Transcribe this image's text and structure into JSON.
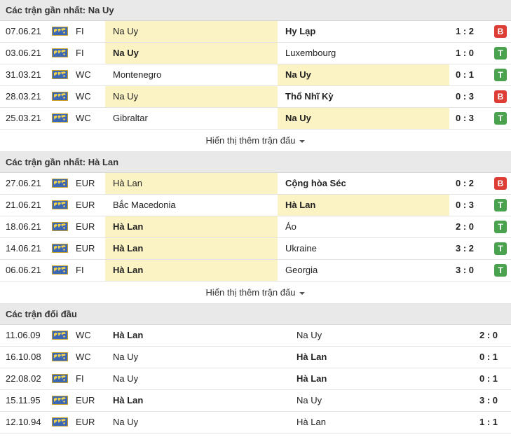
{
  "section1": {
    "title": "Các trận gần nhất: Na Uy",
    "rows": [
      {
        "date": "07.06.21",
        "comp": "FI",
        "home": "Na Uy",
        "away": "Hy Lạp",
        "score": "1 : 2",
        "result": "B",
        "home_hl": true,
        "away_hl": false,
        "home_bold": false,
        "away_bold": true
      },
      {
        "date": "03.06.21",
        "comp": "FI",
        "home": "Na Uy",
        "away": "Luxembourg",
        "score": "1 : 0",
        "result": "T",
        "home_hl": true,
        "away_hl": false,
        "home_bold": true,
        "away_bold": false
      },
      {
        "date": "31.03.21",
        "comp": "WC",
        "home": "Montenegro",
        "away": "Na Uy",
        "score": "0 : 1",
        "result": "T",
        "home_hl": false,
        "away_hl": true,
        "home_bold": false,
        "away_bold": true
      },
      {
        "date": "28.03.21",
        "comp": "WC",
        "home": "Na Uy",
        "away": "Thổ Nhĩ Kỳ",
        "score": "0 : 3",
        "result": "B",
        "home_hl": true,
        "away_hl": false,
        "home_bold": false,
        "away_bold": true
      },
      {
        "date": "25.03.21",
        "comp": "WC",
        "home": "Gibraltar",
        "away": "Na Uy",
        "score": "0 : 3",
        "result": "T",
        "home_hl": false,
        "away_hl": true,
        "home_bold": false,
        "away_bold": true
      }
    ],
    "more": "Hiển thị thêm trận đấu"
  },
  "section2": {
    "title": "Các trận gần nhất: Hà Lan",
    "rows": [
      {
        "date": "27.06.21",
        "comp": "EUR",
        "home": "Hà Lan",
        "away": "Cộng hòa Séc",
        "score": "0 : 2",
        "result": "B",
        "home_hl": true,
        "away_hl": false,
        "home_bold": false,
        "away_bold": true
      },
      {
        "date": "21.06.21",
        "comp": "EUR",
        "home": "Bắc Macedonia",
        "away": "Hà Lan",
        "score": "0 : 3",
        "result": "T",
        "home_hl": false,
        "away_hl": true,
        "home_bold": false,
        "away_bold": true
      },
      {
        "date": "18.06.21",
        "comp": "EUR",
        "home": "Hà Lan",
        "away": "Áo",
        "score": "2 : 0",
        "result": "T",
        "home_hl": true,
        "away_hl": false,
        "home_bold": true,
        "away_bold": false
      },
      {
        "date": "14.06.21",
        "comp": "EUR",
        "home": "Hà Lan",
        "away": "Ukraine",
        "score": "3 : 2",
        "result": "T",
        "home_hl": true,
        "away_hl": false,
        "home_bold": true,
        "away_bold": false
      },
      {
        "date": "06.06.21",
        "comp": "FI",
        "home": "Hà Lan",
        "away": "Georgia",
        "score": "3 : 0",
        "result": "T",
        "home_hl": true,
        "away_hl": false,
        "home_bold": true,
        "away_bold": false
      }
    ],
    "more": "Hiển thị thêm trận đấu"
  },
  "section3": {
    "title": "Các trận đối đầu",
    "rows": [
      {
        "date": "11.06.09",
        "comp": "WC",
        "home": "Hà Lan",
        "away": "Na Uy",
        "score": "2 : 0",
        "home_bold": true,
        "away_bold": false
      },
      {
        "date": "16.10.08",
        "comp": "WC",
        "home": "Na Uy",
        "away": "Hà Lan",
        "score": "0 : 1",
        "home_bold": false,
        "away_bold": true
      },
      {
        "date": "22.08.02",
        "comp": "FI",
        "home": "Na Uy",
        "away": "Hà Lan",
        "score": "0 : 1",
        "home_bold": false,
        "away_bold": true
      },
      {
        "date": "15.11.95",
        "comp": "EUR",
        "home": "Hà Lan",
        "away": "Na Uy",
        "score": "3 : 0",
        "home_bold": true,
        "away_bold": false
      },
      {
        "date": "12.10.94",
        "comp": "EUR",
        "home": "Na Uy",
        "away": "Hà Lan",
        "score": "1 : 1",
        "home_bold": false,
        "away_bold": false
      }
    ]
  },
  "icons": {
    "competition": "world-map-flag-icon",
    "more": "caret-down-icon"
  },
  "colors": {
    "highlight": "#fcf3c4",
    "loss": "#dc3d34",
    "win": "#4aa24f",
    "header_bg": "#e9e9e9"
  }
}
